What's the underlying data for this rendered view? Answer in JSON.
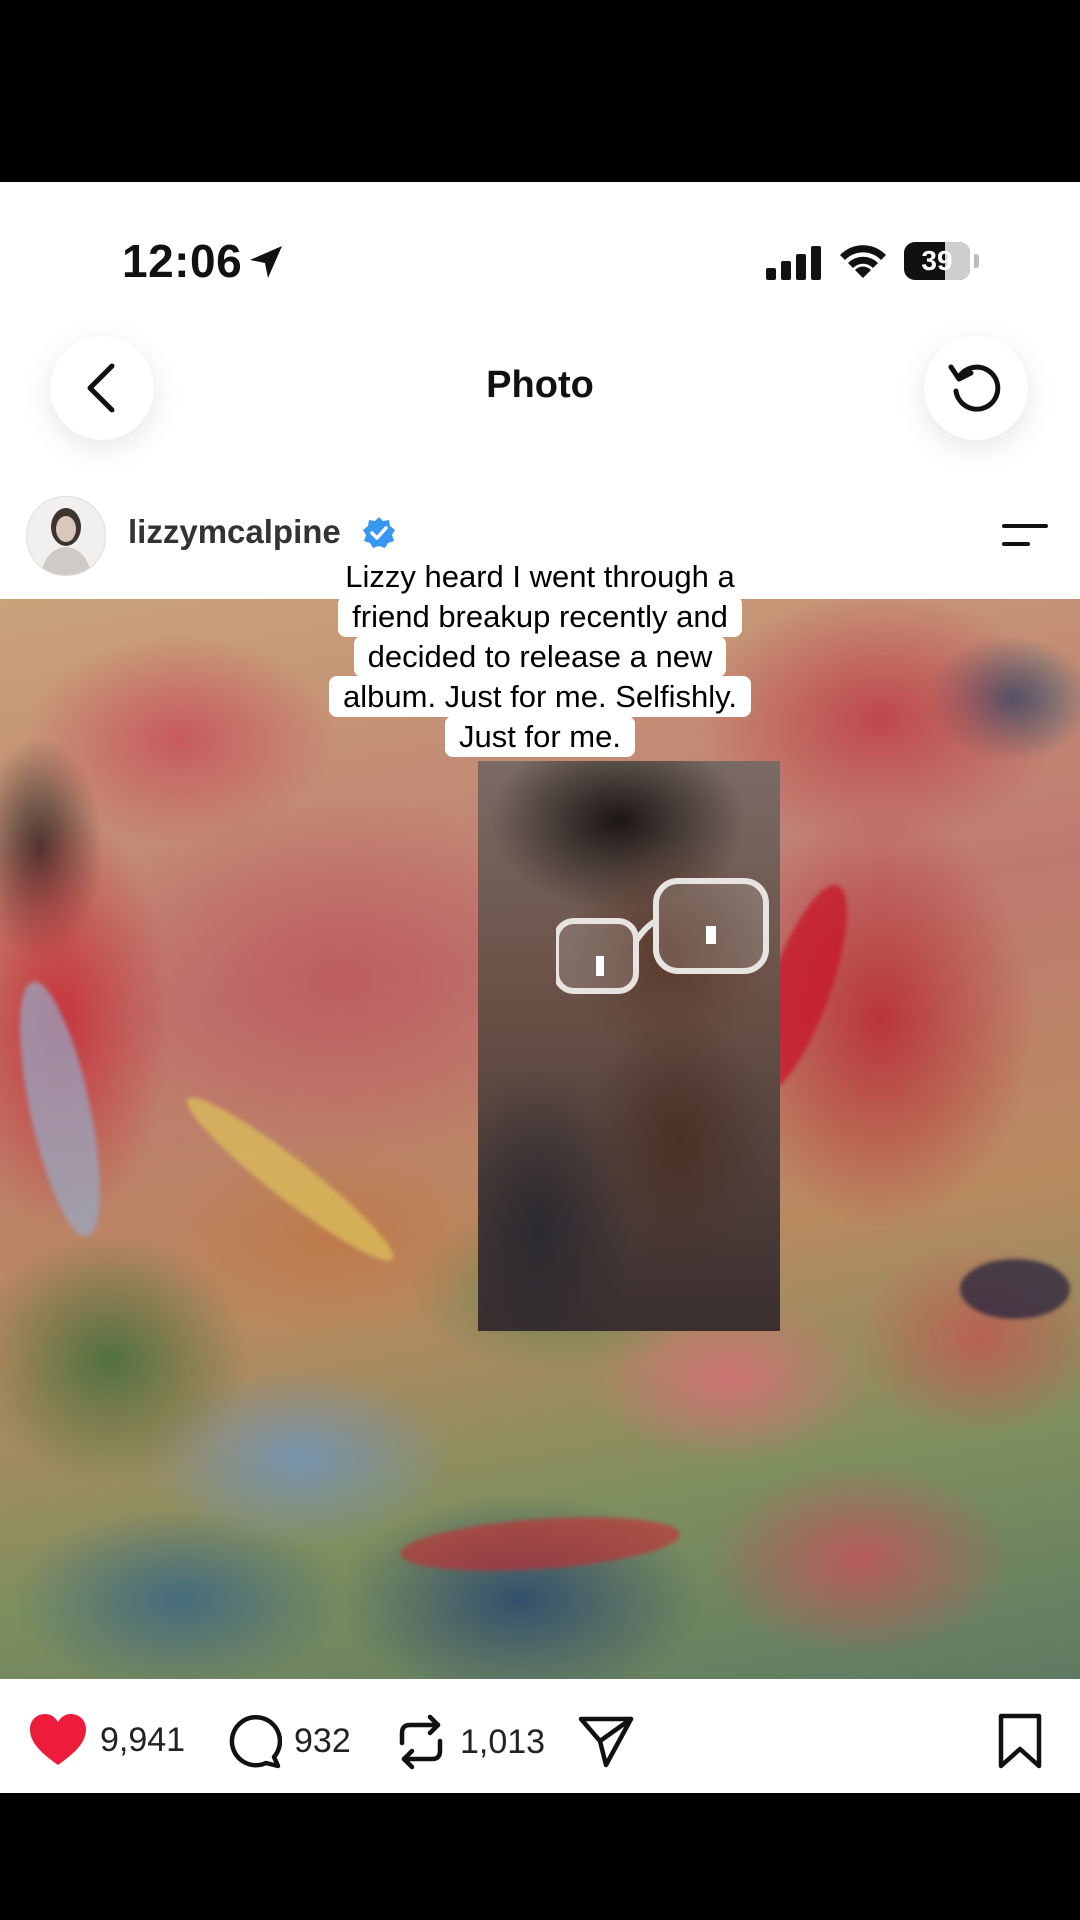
{
  "status_bar": {
    "time": "12:06",
    "battery_percent": "39"
  },
  "header": {
    "title": "Photo"
  },
  "post": {
    "username": "lizzymcalpine",
    "verified": true,
    "caption_lines": [
      "Lizzy heard I went through a",
      "friend breakup recently and",
      "decided to release a new",
      "album. Just for me. Selfishly.",
      "Just for me."
    ]
  },
  "actions": {
    "likes": "9,941",
    "comments": "932",
    "reposts": "1,013",
    "liked": true,
    "like_color": "#ed1c3a"
  },
  "colors": {
    "verified_badge": "#3897f0",
    "background": "#ffffff"
  }
}
